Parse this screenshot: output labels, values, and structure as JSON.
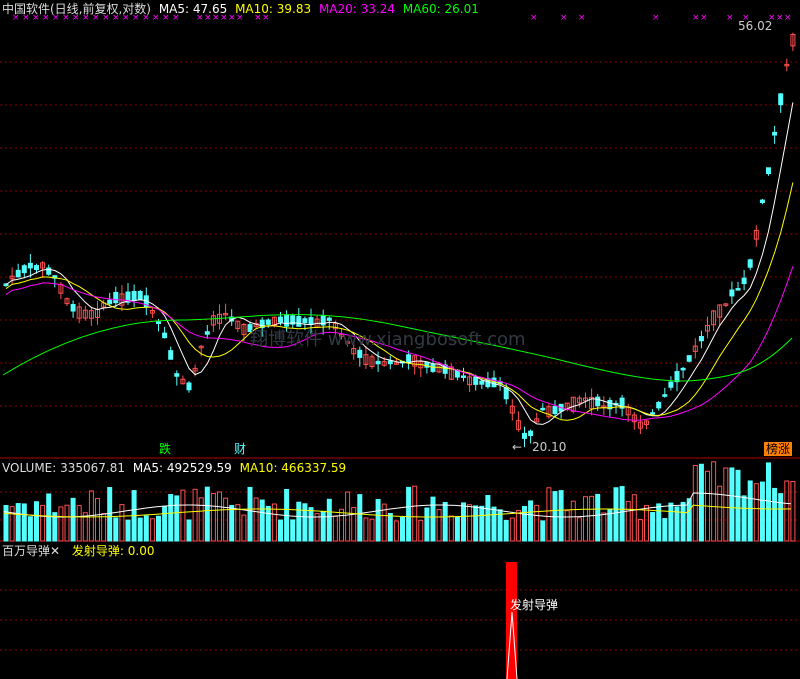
{
  "price_panel": {
    "title": "中国软件(日线,前复权,对数)",
    "ma5": "MA5: 47.65",
    "ma10": "MA10: 39.83",
    "ma20": "MA20: 33.24",
    "ma60": "MA60: 26.01",
    "high_label": "56.02",
    "low_label": "20.10",
    "watermark": "翔博软件 www.xiangbosoft.com",
    "badge_down": "跌",
    "badge_cai": "财",
    "badge_limit": "榜涨"
  },
  "volume_panel": {
    "volume": "VOLUME: 335067.81",
    "ma5": "MA5: 492529.59",
    "ma10": "MA10: 466337.59"
  },
  "indicator_panel": {
    "name": "百万导弹",
    "close_mark": "✕",
    "value": "发射导弹: 0.00",
    "signal_label": "发射导弹"
  },
  "colors": {
    "up": "#ff5050",
    "down": "#54ffff",
    "ma5": "#ffffff",
    "ma10": "#ffff00",
    "ma20": "#ff00ff",
    "ma60": "#00ff00",
    "grid": "#8b0000",
    "signal": "#ff0000"
  },
  "chart_data": {
    "type": "candlestick",
    "price_axis": "log",
    "price_max": 56.02,
    "price_min": 20.1
  }
}
